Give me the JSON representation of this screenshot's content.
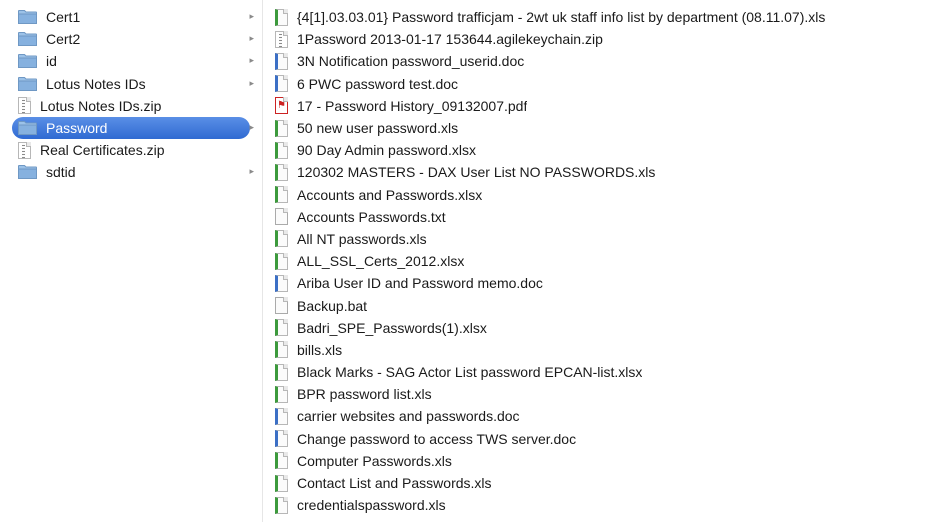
{
  "sidebar": {
    "items": [
      {
        "label": "Cert1",
        "kind": "folder",
        "chevron": "▸",
        "selected": false
      },
      {
        "label": "Cert2",
        "kind": "folder",
        "chevron": "▸",
        "selected": false
      },
      {
        "label": "id",
        "kind": "folder",
        "chevron": "▸",
        "selected": false
      },
      {
        "label": "Lotus Notes IDs",
        "kind": "folder",
        "chevron": "▸",
        "selected": false
      },
      {
        "label": "Lotus Notes IDs.zip",
        "kind": "zip",
        "chevron": "",
        "selected": false
      },
      {
        "label": "Password",
        "kind": "folder",
        "chevron": "▸",
        "selected": true
      },
      {
        "label": "Real Certificates.zip",
        "kind": "zip",
        "chevron": "",
        "selected": false
      },
      {
        "label": "sdtid",
        "kind": "folder",
        "chevron": "▸",
        "selected": false
      }
    ]
  },
  "files": {
    "items": [
      {
        "label": "{4[1].03.03.01} Password trafficjam - 2wt uk staff info list by department (08.11.07).xls",
        "kind": "xls"
      },
      {
        "label": "1Password 2013-01-17 153644.agilekeychain.zip",
        "kind": "zip"
      },
      {
        "label": "3N Notification password_userid.doc",
        "kind": "word"
      },
      {
        "label": "6 PWC password test.doc",
        "kind": "word"
      },
      {
        "label": "17 - Password History_09132007.pdf",
        "kind": "pdf"
      },
      {
        "label": "50 new user password.xls",
        "kind": "xls"
      },
      {
        "label": "90 Day Admin password.xlsx",
        "kind": "xls"
      },
      {
        "label": "120302 MASTERS - DAX User List NO PASSWORDS.xls",
        "kind": "xls"
      },
      {
        "label": "Accounts and Passwords.xlsx",
        "kind": "xls"
      },
      {
        "label": "Accounts Passwords.txt",
        "kind": "txt"
      },
      {
        "label": "All NT passwords.xls",
        "kind": "xls"
      },
      {
        "label": "ALL_SSL_Certs_2012.xlsx",
        "kind": "xls"
      },
      {
        "label": "Ariba User ID and Password memo.doc",
        "kind": "word"
      },
      {
        "label": "Backup.bat",
        "kind": "txt"
      },
      {
        "label": "Badri_SPE_Passwords(1).xlsx",
        "kind": "xls"
      },
      {
        "label": "bills.xls",
        "kind": "xls"
      },
      {
        "label": "Black Marks - SAG Actor List password EPCAN-list.xlsx",
        "kind": "xls"
      },
      {
        "label": "BPR password list.xls",
        "kind": "xls"
      },
      {
        "label": "carrier websites and passwords.doc",
        "kind": "word"
      },
      {
        "label": "Change password to access TWS server.doc",
        "kind": "word"
      },
      {
        "label": "Computer Passwords.xls",
        "kind": "xls"
      },
      {
        "label": "Contact List and Passwords.xls",
        "kind": "xls"
      },
      {
        "label": "credentialspassword.xls",
        "kind": "xls"
      }
    ]
  },
  "icons": {
    "folder": "folder-icon",
    "zip": "zip-file-icon",
    "xls": "spreadsheet-file-icon",
    "word": "word-document-icon",
    "pdf": "pdf-file-icon",
    "txt": "text-file-icon",
    "chevron": "chevron-right-icon"
  },
  "colors": {
    "selection": "#3a76d8",
    "folder": "#8fb8e0",
    "xls_accent": "#3c9a3c",
    "word_accent": "#3b6fc5",
    "pdf_accent": "#cc2222"
  }
}
